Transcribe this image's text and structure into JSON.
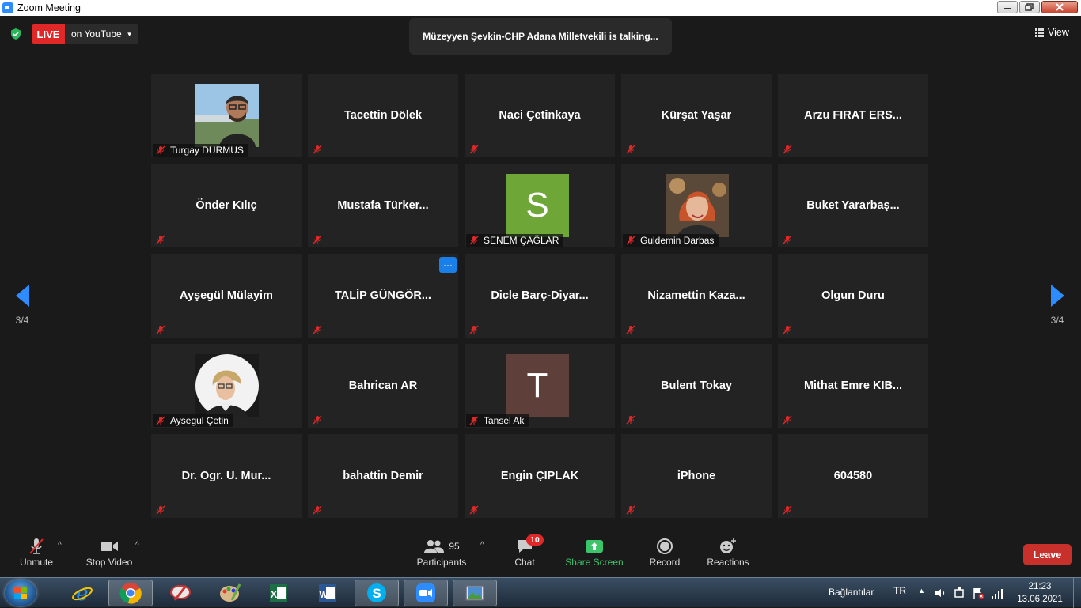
{
  "window": {
    "title": "Zoom Meeting"
  },
  "live": {
    "badge": "LIVE",
    "destination": "on YouTube"
  },
  "talking_banner": "Müzeyyen Şevkin-CHP Adana Milletvekili is talking...",
  "view_label": "View",
  "pager": {
    "left": "3/4",
    "right": "3/4"
  },
  "participants": [
    {
      "name": "Turgay DURMUS",
      "type": "photo",
      "photo": "man-glasses"
    },
    {
      "name": "Tacettin Dölek",
      "type": "name"
    },
    {
      "name": "Naci Çetinkaya",
      "type": "name"
    },
    {
      "name": "Kürşat Yaşar",
      "type": "name"
    },
    {
      "name": "Arzu FIRAT ERS...",
      "type": "name"
    },
    {
      "name": "Önder Kılıç",
      "type": "name"
    },
    {
      "name": "Mustafa  Türker...",
      "type": "name"
    },
    {
      "name": "SENEM ÇAĞLAR",
      "type": "avatar",
      "initial": "S",
      "color": "#6ea638"
    },
    {
      "name": "Guldemin Darbas",
      "type": "photo",
      "photo": "woman-red-hair"
    },
    {
      "name": "Buket  Yararbaş...",
      "type": "name"
    },
    {
      "name": "Ayşegül Mülayim",
      "type": "name"
    },
    {
      "name": "TALİP  GÜNGÖR...",
      "type": "name",
      "more": "···"
    },
    {
      "name": "Dicle  Barç-Diyar...",
      "type": "name"
    },
    {
      "name": "Nizamettin  Kaza...",
      "type": "name"
    },
    {
      "name": "Olgun Duru",
      "type": "name"
    },
    {
      "name": "Aysegul Çetin",
      "type": "photo",
      "photo": "woman-round"
    },
    {
      "name": "Bahrican AR",
      "type": "name"
    },
    {
      "name": "Tansel Ak",
      "type": "avatar",
      "initial": "T",
      "color": "#5e3f39"
    },
    {
      "name": "Bulent Tokay",
      "type": "name"
    },
    {
      "name": "Mithat  Emre KIB...",
      "type": "name"
    },
    {
      "name": "Dr. Ogr. U. Mur...",
      "type": "name"
    },
    {
      "name": "bahattin Demir",
      "type": "name"
    },
    {
      "name": "Engin ÇIPLAK",
      "type": "name"
    },
    {
      "name": "iPhone",
      "type": "name"
    },
    {
      "name": "604580",
      "type": "name"
    }
  ],
  "toolbar": {
    "unmute": "Unmute",
    "stop_video": "Stop Video",
    "participants_label": "Participants",
    "participants_count": "95",
    "chat": "Chat",
    "chat_badge": "10",
    "share_screen": "Share Screen",
    "record": "Record",
    "reactions": "Reactions",
    "leave": "Leave"
  },
  "taskbar": {
    "apps": [
      "internet-explorer",
      "chrome",
      "paint-tool",
      "paint",
      "excel",
      "word",
      "skype",
      "zoom",
      "photo-viewer"
    ],
    "tray_label": "Bağlantılar",
    "language": "TR",
    "time": "21:23",
    "date": "13.06.2021"
  },
  "colors": {
    "accent": "#2d8cff",
    "live": "#e02828",
    "share": "#3cc46a",
    "leave": "#c8302c",
    "tile": "#232323",
    "muted_icon": "#e02828"
  }
}
